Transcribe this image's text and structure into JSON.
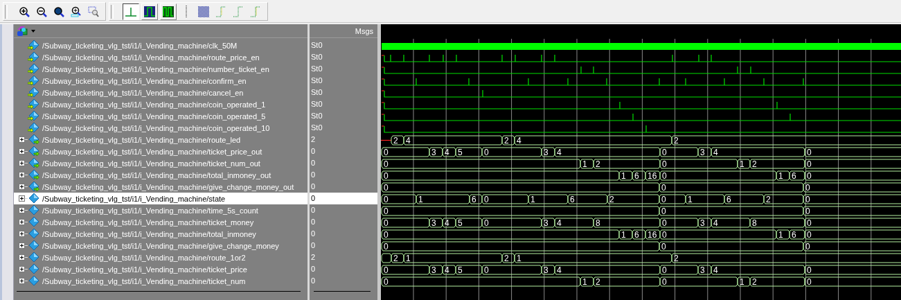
{
  "wave_header": {
    "msgs_label": "Msgs"
  },
  "rows": [
    {
      "name": "/Subway_ticketing_vlg_tst/i1/i_Vending_machine/clk_50M",
      "value": "St0",
      "kind": "input",
      "selected": false
    },
    {
      "name": "/Subway_ticketing_vlg_tst/i1/i_Vending_machine/route_price_en",
      "value": "St0",
      "kind": "input",
      "selected": false
    },
    {
      "name": "/Subway_ticketing_vlg_tst/i1/i_Vending_machine/number_ticket_en",
      "value": "St0",
      "kind": "input",
      "selected": false
    },
    {
      "name": "/Subway_ticketing_vlg_tst/i1/i_Vending_machine/confirm_en",
      "value": "St0",
      "kind": "input",
      "selected": false
    },
    {
      "name": "/Subway_ticketing_vlg_tst/i1/i_Vending_machine/cancel_en",
      "value": "St0",
      "kind": "input",
      "selected": false
    },
    {
      "name": "/Subway_ticketing_vlg_tst/i1/i_Vending_machine/coin_operated_1",
      "value": "St0",
      "kind": "input",
      "selected": false
    },
    {
      "name": "/Subway_ticketing_vlg_tst/i1/i_Vending_machine/coin_operated_5",
      "value": "St0",
      "kind": "input",
      "selected": false
    },
    {
      "name": "/Subway_ticketing_vlg_tst/i1/i_Vending_machine/coin_operated_10",
      "value": "St0",
      "kind": "input",
      "selected": false
    },
    {
      "name": "/Subway_ticketing_vlg_tst/i1/i_Vending_machine/route_led",
      "value": "2",
      "kind": "output",
      "expanded": false,
      "selected": false,
      "segments": [
        "2",
        "4",
        "2",
        "4",
        "2"
      ]
    },
    {
      "name": "/Subway_ticketing_vlg_tst/i1/i_Vending_machine/ticket_price_out",
      "value": "0",
      "kind": "output",
      "expanded": false,
      "selected": false,
      "segments": [
        "0",
        "3",
        "4",
        "5",
        "0",
        "3",
        "4",
        "0",
        "3",
        "4",
        "0"
      ]
    },
    {
      "name": "/Subway_ticketing_vlg_tst/i1/i_Vending_machine/ticket_num_out",
      "value": "0",
      "kind": "output",
      "expanded": false,
      "selected": false,
      "segments": [
        "0",
        "1",
        "2",
        "0",
        "1",
        "2",
        "0"
      ]
    },
    {
      "name": "/Subway_ticketing_vlg_tst/i1/i_Vending_machine/total_inmoney_out",
      "value": "0",
      "kind": "output",
      "expanded": false,
      "selected": false,
      "segments": [
        "0",
        "1",
        "6",
        "16",
        "0",
        "1",
        "6",
        "0"
      ]
    },
    {
      "name": "/Subway_ticketing_vlg_tst/i1/i_Vending_machine/give_change_money_out",
      "value": "0",
      "kind": "output",
      "expanded": false,
      "selected": false,
      "segments": [
        "0",
        "0",
        "0"
      ]
    },
    {
      "name": "/Subway_ticketing_vlg_tst/i1/i_Vending_machine/state",
      "value": "0",
      "kind": "internal",
      "expanded": false,
      "selected": true,
      "segments": [
        "0",
        "1",
        "6",
        "0",
        "1",
        "6",
        "2",
        "0",
        "1",
        "6",
        "2",
        "0"
      ]
    },
    {
      "name": "/Subway_ticketing_vlg_tst/i1/i_Vending_machine/time_5s_count",
      "value": "0",
      "kind": "internal",
      "expanded": false,
      "selected": false,
      "segments": [
        "0",
        "0",
        "0"
      ]
    },
    {
      "name": "/Subway_ticketing_vlg_tst/i1/i_Vending_machine/ticket_money",
      "value": "0",
      "kind": "internal",
      "expanded": false,
      "selected": false,
      "segments": [
        "0",
        "3",
        "4",
        "5",
        "0",
        "3",
        "4",
        "8",
        "0",
        "3",
        "4",
        "8",
        "0"
      ]
    },
    {
      "name": "/Subway_ticketing_vlg_tst/i1/i_Vending_machine/total_inmoney",
      "value": "0",
      "kind": "internal",
      "expanded": false,
      "selected": false,
      "segments": [
        "0",
        "1",
        "6",
        "16",
        "0",
        "1",
        "6",
        "0"
      ]
    },
    {
      "name": "/Subway_ticketing_vlg_tst/i1/i_Vending_machine/give_change_money",
      "value": "0",
      "kind": "internal",
      "expanded": false,
      "selected": false,
      "segments": [
        "0",
        "0",
        "0"
      ]
    },
    {
      "name": "/Subway_ticketing_vlg_tst/i1/i_Vending_machine/route_1or2",
      "value": "2",
      "kind": "internal",
      "expanded": false,
      "selected": false,
      "segments": [
        "2",
        "1",
        "2",
        "1",
        "2"
      ]
    },
    {
      "name": "/Subway_ticketing_vlg_tst/i1/i_Vending_machine/ticket_price",
      "value": "0",
      "kind": "internal",
      "expanded": false,
      "selected": false,
      "segments": [
        "0",
        "3",
        "4",
        "5",
        "0",
        "3",
        "4",
        "0",
        "3",
        "4",
        "0"
      ]
    },
    {
      "name": "/Subway_ticketing_vlg_tst/i1/i_Vending_machine/ticket_num",
      "value": "0",
      "kind": "internal",
      "expanded": false,
      "selected": false,
      "segments": [
        "0",
        "1",
        "2",
        "0",
        "1",
        "2",
        "0"
      ]
    }
  ]
}
